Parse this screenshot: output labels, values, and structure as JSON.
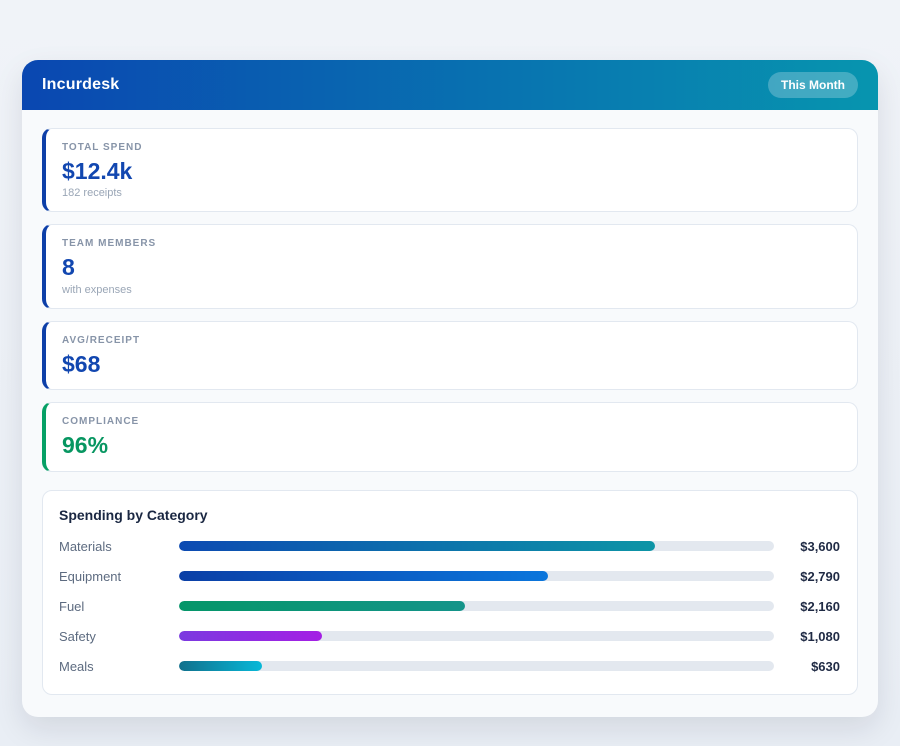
{
  "header": {
    "title": "Incurdesk",
    "badge": "This Month",
    "gradient_from": "#0a47b1",
    "gradient_to": "#0795af"
  },
  "stats": [
    {
      "label": "TOTAL SPEND",
      "value": "$12.4k",
      "sub": "182 receipts",
      "accent": "#0d3fa8",
      "value_color": "#1247b0"
    },
    {
      "label": "TEAM MEMBERS",
      "value": "8",
      "sub": "with expenses",
      "accent": "#0d3fa8",
      "value_color": "#1247b0"
    },
    {
      "label": "AVG/RECEIPT",
      "value": "$68",
      "sub": "",
      "accent": "#0d3fa8",
      "value_color": "#1247b0"
    },
    {
      "label": "COMPLIANCE",
      "value": "96%",
      "sub": "",
      "accent": "#06a065",
      "value_color": "#079661"
    }
  ],
  "chart": {
    "title": "Spending by Category",
    "max": 4500,
    "rows": [
      {
        "label": "Materials",
        "value_label": "$3,600",
        "amount": 3600,
        "pct": 80,
        "from": "#0c4ab2",
        "to": "#0d95a6"
      },
      {
        "label": "Equipment",
        "value_label": "$2,790",
        "amount": 2790,
        "pct": 62,
        "from": "#0b3fa6",
        "to": "#0b76dc"
      },
      {
        "label": "Fuel",
        "value_label": "$2,160",
        "amount": 2160,
        "pct": 48,
        "from": "#059669",
        "to": "#14948a"
      },
      {
        "label": "Safety",
        "value_label": "$1,080",
        "amount": 1080,
        "pct": 24,
        "from": "#7b3ae0",
        "to": "#a41fe4"
      },
      {
        "label": "Meals",
        "value_label": "$630",
        "amount": 630,
        "pct": 14,
        "from": "#10708c",
        "to": "#08b8d8"
      }
    ]
  },
  "chart_data": {
    "type": "bar",
    "orientation": "horizontal",
    "title": "Spending by Category",
    "categories": [
      "Materials",
      "Equipment",
      "Fuel",
      "Safety",
      "Meals"
    ],
    "values": [
      3600,
      2790,
      2160,
      1080,
      630
    ],
    "value_labels": [
      "$3,600",
      "$2,790",
      "$2,160",
      "$1,080",
      "$630"
    ],
    "xlim": [
      0,
      4500
    ],
    "grid": false,
    "legend": false,
    "bar_gradients": [
      [
        "#0c4ab2",
        "#0d95a6"
      ],
      [
        "#0b3fa6",
        "#0b76dc"
      ],
      [
        "#059669",
        "#14948a"
      ],
      [
        "#7b3ae0",
        "#a41fe4"
      ],
      [
        "#10708c",
        "#08b8d8"
      ]
    ],
    "track_color": "#e3e8ef"
  }
}
